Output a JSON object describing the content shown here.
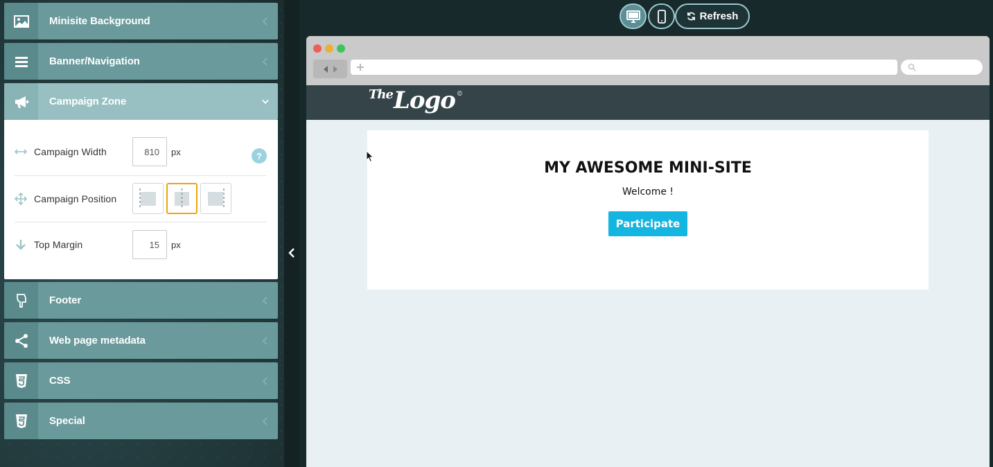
{
  "sidebar": {
    "sections": [
      {
        "label": "Minisite Background",
        "icon": "image-icon"
      },
      {
        "label": "Banner/Navigation",
        "icon": "menu-icon"
      },
      {
        "label": "Campaign Zone",
        "icon": "megaphone-icon",
        "expanded": true
      },
      {
        "label": "Footer",
        "icon": "pointing-hand-icon"
      },
      {
        "label": "Web page metadata",
        "icon": "share-icon"
      },
      {
        "label": "CSS",
        "icon": "css3-icon"
      },
      {
        "label": "Special",
        "icon": "css3-icon"
      }
    ],
    "campaign_zone": {
      "width_label": "Campaign Width",
      "width_value": "810",
      "width_unit": "px",
      "help_label": "?",
      "position_label": "Campaign Position",
      "position_options": [
        "left",
        "center",
        "right"
      ],
      "position_selected": "center",
      "top_margin_label": "Top Margin",
      "top_margin_value": "15",
      "top_margin_unit": "px"
    }
  },
  "toolbar": {
    "desktop_icon": "desktop-icon",
    "mobile_icon": "mobile-icon",
    "refresh_label": "Refresh",
    "active_device": "desktop"
  },
  "preview": {
    "logo_the": "The",
    "logo_main": "Logo",
    "logo_mark": "©",
    "site_title": "MY AWESOME MINI-SITE",
    "welcome": "Welcome !",
    "cta_label": "Participate"
  },
  "colors": {
    "section_bg": "#6a9a9c",
    "section_active_bg": "#98c0c2",
    "selected_border": "#f0a30a",
    "cta_bg": "#14b5e0",
    "site_header_bg": "#344448"
  }
}
